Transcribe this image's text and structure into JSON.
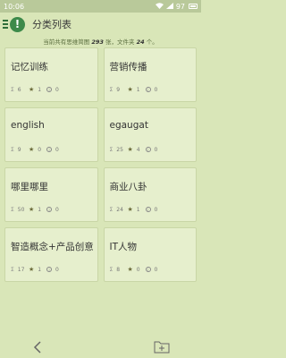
{
  "status_bar": {
    "time": "10:06",
    "battery": "97"
  },
  "app_bar": {
    "logo_glyph": "!",
    "title": "分类列表"
  },
  "summary": {
    "prefix": "当前共有思维简图 ",
    "map_count": "293",
    "middle": " 张，文件夹 ",
    "folder_count": "24",
    "suffix": " 个。"
  },
  "categories": [
    {
      "name": "记忆训练",
      "sum": "6",
      "stars": "1",
      "info": "0"
    },
    {
      "name": "营销传播",
      "sum": "9",
      "stars": "1",
      "info": "0"
    },
    {
      "name": "english",
      "sum": "9",
      "stars": "0",
      "info": "0"
    },
    {
      "name": "egaugat",
      "sum": "25",
      "stars": "4",
      "info": "0"
    },
    {
      "name": "哪里哪里",
      "sum": "50",
      "stars": "1",
      "info": "0"
    },
    {
      "name": "商业八卦",
      "sum": "24",
      "stars": "1",
      "info": "0"
    },
    {
      "name": "智造概念+产品创意",
      "sum": "17",
      "stars": "1",
      "info": "0"
    },
    {
      "name": "IT人物",
      "sum": "8",
      "stars": "0",
      "info": "0"
    }
  ],
  "icons": {
    "sum": "sigma-icon",
    "star": "star-icon",
    "info": "info-icon",
    "back": "back-arrow-icon",
    "add_folder": "add-folder-icon"
  },
  "colors": {
    "background": "#d9e6b8",
    "card": "#e6efcd",
    "accent": "#3d8a4a"
  }
}
